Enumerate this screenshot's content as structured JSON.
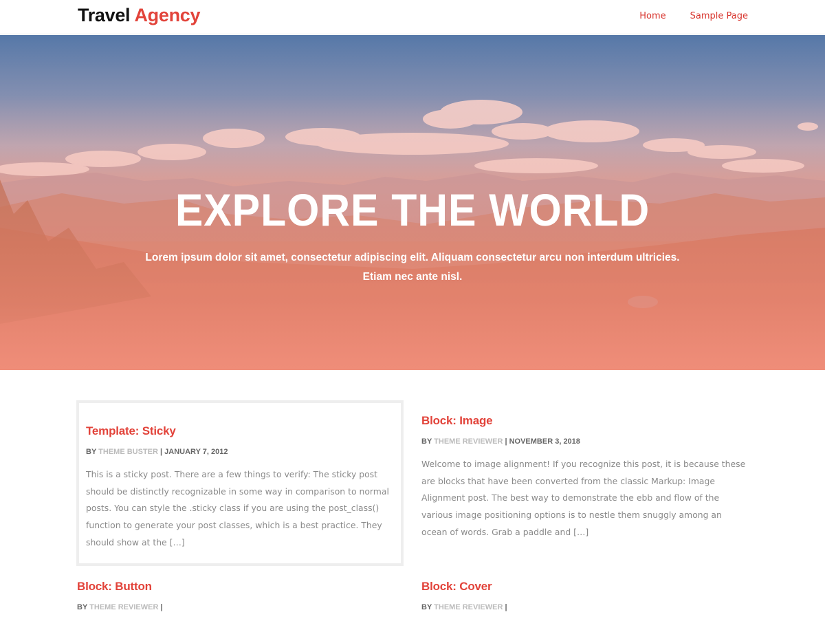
{
  "site": {
    "brand_part1": "Travel",
    "brand_part2": "Agency",
    "nav": [
      {
        "label": "Home"
      },
      {
        "label": "Sample Page"
      }
    ],
    "accent_color": "#e2433a"
  },
  "hero": {
    "title": "EXPLORE THE WORLD",
    "subtitle": "Lorem ipsum dolor sit amet, consectetur adipiscing elit. Aliquam consectetur arcu non interdum ultricies. Etiam nec ante nisl."
  },
  "posts": [
    {
      "title": "Template: Sticky",
      "by": "BY",
      "author": "THEME BUSTER",
      "separator": "|",
      "date": "JANUARY 7, 2012",
      "excerpt": "This is a sticky post. There are a few things to verify: The sticky post should be distinctly recognizable in some way in comparison to normal posts. You can style the .sticky class if you are using the post_class() function to generate your post classes, which is a best practice. They should show at the […]"
    },
    {
      "title": "Block: Image",
      "by": "BY",
      "author": "THEME REVIEWER",
      "separator": "|",
      "date": "NOVEMBER 3, 2018",
      "excerpt": "Welcome to image alignment! If you recognize this post, it is because these are blocks that have been converted from the classic Markup: Image Alignment post. The best way to demonstrate the ebb and flow of the various image positioning options is to nestle them snuggly among an ocean of words. Grab a paddle and […]"
    },
    {
      "title": "Block: Button",
      "by": "BY",
      "author": "THEME REVIEWER",
      "separator": "|",
      "date": ""
    },
    {
      "title": "Block: Cover",
      "by": "BY",
      "author": "THEME REVIEWER",
      "separator": "|",
      "date": ""
    }
  ]
}
